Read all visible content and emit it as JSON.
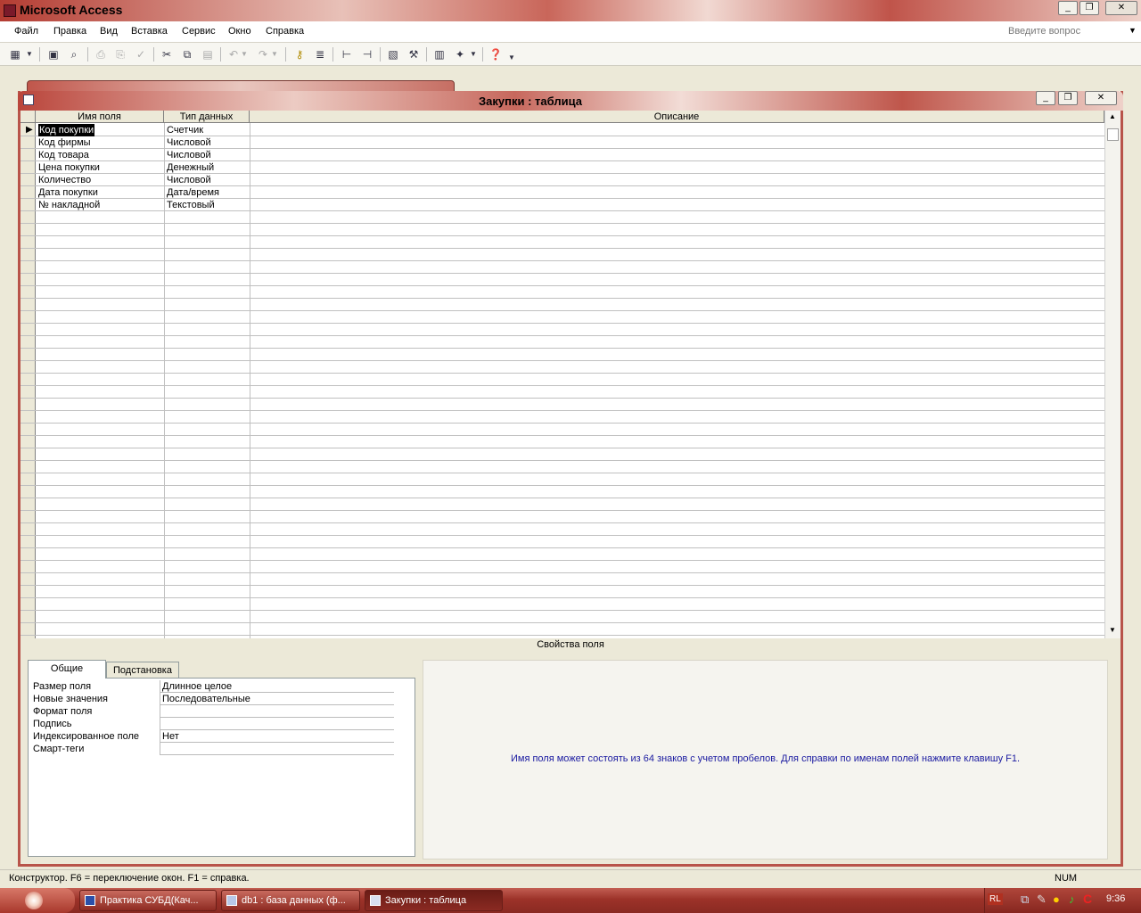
{
  "app": {
    "title": "Microsoft Access"
  },
  "menu": [
    "Файл",
    "Правка",
    "Вид",
    "Вставка",
    "Сервис",
    "Окно",
    "Справка"
  ],
  "ask_placeholder": "Введите вопрос",
  "window": {
    "title": "Закупки : таблица"
  },
  "grid": {
    "headers": [
      "Имя поля",
      "Тип данных",
      "Описание"
    ],
    "rows": [
      {
        "name": "Код покупки",
        "type": "Счетчик"
      },
      {
        "name": "Код фирмы",
        "type": "Числовой"
      },
      {
        "name": "Код товара",
        "type": "Числовой"
      },
      {
        "name": "Цена покупки",
        "type": "Денежный"
      },
      {
        "name": "Количество",
        "type": "Числовой"
      },
      {
        "name": "Дата покупки",
        "type": "Дата/время"
      },
      {
        "name": "№ накладной",
        "type": "Текстовый"
      }
    ]
  },
  "properties": {
    "label": "Свойства поля",
    "tabs": [
      "Общие",
      "Подстановка"
    ],
    "items": [
      {
        "label": "Размер поля",
        "value": "Длинное целое"
      },
      {
        "label": "Новые значения",
        "value": "Последовательные"
      },
      {
        "label": "Формат поля",
        "value": ""
      },
      {
        "label": "Подпись",
        "value": ""
      },
      {
        "label": "Индексированное поле",
        "value": "Нет"
      },
      {
        "label": "Смарт-теги",
        "value": ""
      }
    ],
    "hint": "Имя поля может состоять из 64 знаков с учетом пробелов.  Для справки по именам полей нажмите клавишу F1."
  },
  "status": {
    "left": "Конструктор.  F6 = переключение окон.  F1 = справка.",
    "num": "NUM"
  },
  "taskbar": {
    "tasks": [
      "Практика СУБД(Кач...",
      "db1 : база данных (ф...",
      "Закупки : таблица"
    ],
    "lang": "RL",
    "clock": "9:36"
  }
}
